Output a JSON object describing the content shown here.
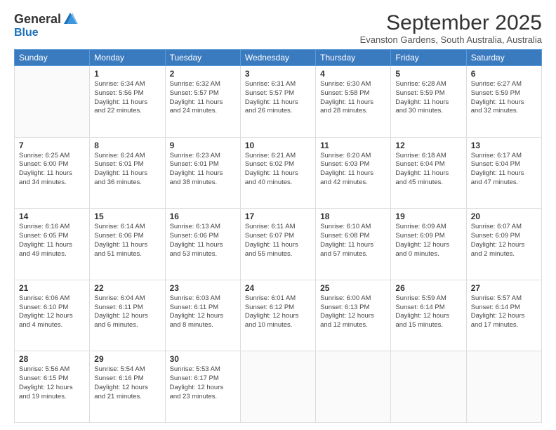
{
  "header": {
    "logo_general": "General",
    "logo_blue": "Blue",
    "month_title": "September 2025",
    "location": "Evanston Gardens, South Australia, Australia"
  },
  "weekdays": [
    "Sunday",
    "Monday",
    "Tuesday",
    "Wednesday",
    "Thursday",
    "Friday",
    "Saturday"
  ],
  "weeks": [
    [
      {
        "day": "",
        "info": ""
      },
      {
        "day": "1",
        "info": "Sunrise: 6:34 AM\nSunset: 5:56 PM\nDaylight: 11 hours\nand 22 minutes."
      },
      {
        "day": "2",
        "info": "Sunrise: 6:32 AM\nSunset: 5:57 PM\nDaylight: 11 hours\nand 24 minutes."
      },
      {
        "day": "3",
        "info": "Sunrise: 6:31 AM\nSunset: 5:57 PM\nDaylight: 11 hours\nand 26 minutes."
      },
      {
        "day": "4",
        "info": "Sunrise: 6:30 AM\nSunset: 5:58 PM\nDaylight: 11 hours\nand 28 minutes."
      },
      {
        "day": "5",
        "info": "Sunrise: 6:28 AM\nSunset: 5:59 PM\nDaylight: 11 hours\nand 30 minutes."
      },
      {
        "day": "6",
        "info": "Sunrise: 6:27 AM\nSunset: 5:59 PM\nDaylight: 11 hours\nand 32 minutes."
      }
    ],
    [
      {
        "day": "7",
        "info": "Sunrise: 6:25 AM\nSunset: 6:00 PM\nDaylight: 11 hours\nand 34 minutes."
      },
      {
        "day": "8",
        "info": "Sunrise: 6:24 AM\nSunset: 6:01 PM\nDaylight: 11 hours\nand 36 minutes."
      },
      {
        "day": "9",
        "info": "Sunrise: 6:23 AM\nSunset: 6:01 PM\nDaylight: 11 hours\nand 38 minutes."
      },
      {
        "day": "10",
        "info": "Sunrise: 6:21 AM\nSunset: 6:02 PM\nDaylight: 11 hours\nand 40 minutes."
      },
      {
        "day": "11",
        "info": "Sunrise: 6:20 AM\nSunset: 6:03 PM\nDaylight: 11 hours\nand 42 minutes."
      },
      {
        "day": "12",
        "info": "Sunrise: 6:18 AM\nSunset: 6:04 PM\nDaylight: 11 hours\nand 45 minutes."
      },
      {
        "day": "13",
        "info": "Sunrise: 6:17 AM\nSunset: 6:04 PM\nDaylight: 11 hours\nand 47 minutes."
      }
    ],
    [
      {
        "day": "14",
        "info": "Sunrise: 6:16 AM\nSunset: 6:05 PM\nDaylight: 11 hours\nand 49 minutes."
      },
      {
        "day": "15",
        "info": "Sunrise: 6:14 AM\nSunset: 6:06 PM\nDaylight: 11 hours\nand 51 minutes."
      },
      {
        "day": "16",
        "info": "Sunrise: 6:13 AM\nSunset: 6:06 PM\nDaylight: 11 hours\nand 53 minutes."
      },
      {
        "day": "17",
        "info": "Sunrise: 6:11 AM\nSunset: 6:07 PM\nDaylight: 11 hours\nand 55 minutes."
      },
      {
        "day": "18",
        "info": "Sunrise: 6:10 AM\nSunset: 6:08 PM\nDaylight: 11 hours\nand 57 minutes."
      },
      {
        "day": "19",
        "info": "Sunrise: 6:09 AM\nSunset: 6:09 PM\nDaylight: 12 hours\nand 0 minutes."
      },
      {
        "day": "20",
        "info": "Sunrise: 6:07 AM\nSunset: 6:09 PM\nDaylight: 12 hours\nand 2 minutes."
      }
    ],
    [
      {
        "day": "21",
        "info": "Sunrise: 6:06 AM\nSunset: 6:10 PM\nDaylight: 12 hours\nand 4 minutes."
      },
      {
        "day": "22",
        "info": "Sunrise: 6:04 AM\nSunset: 6:11 PM\nDaylight: 12 hours\nand 6 minutes."
      },
      {
        "day": "23",
        "info": "Sunrise: 6:03 AM\nSunset: 6:11 PM\nDaylight: 12 hours\nand 8 minutes."
      },
      {
        "day": "24",
        "info": "Sunrise: 6:01 AM\nSunset: 6:12 PM\nDaylight: 12 hours\nand 10 minutes."
      },
      {
        "day": "25",
        "info": "Sunrise: 6:00 AM\nSunset: 6:13 PM\nDaylight: 12 hours\nand 12 minutes."
      },
      {
        "day": "26",
        "info": "Sunrise: 5:59 AM\nSunset: 6:14 PM\nDaylight: 12 hours\nand 15 minutes."
      },
      {
        "day": "27",
        "info": "Sunrise: 5:57 AM\nSunset: 6:14 PM\nDaylight: 12 hours\nand 17 minutes."
      }
    ],
    [
      {
        "day": "28",
        "info": "Sunrise: 5:56 AM\nSunset: 6:15 PM\nDaylight: 12 hours\nand 19 minutes."
      },
      {
        "day": "29",
        "info": "Sunrise: 5:54 AM\nSunset: 6:16 PM\nDaylight: 12 hours\nand 21 minutes."
      },
      {
        "day": "30",
        "info": "Sunrise: 5:53 AM\nSunset: 6:17 PM\nDaylight: 12 hours\nand 23 minutes."
      },
      {
        "day": "",
        "info": ""
      },
      {
        "day": "",
        "info": ""
      },
      {
        "day": "",
        "info": ""
      },
      {
        "day": "",
        "info": ""
      }
    ]
  ]
}
